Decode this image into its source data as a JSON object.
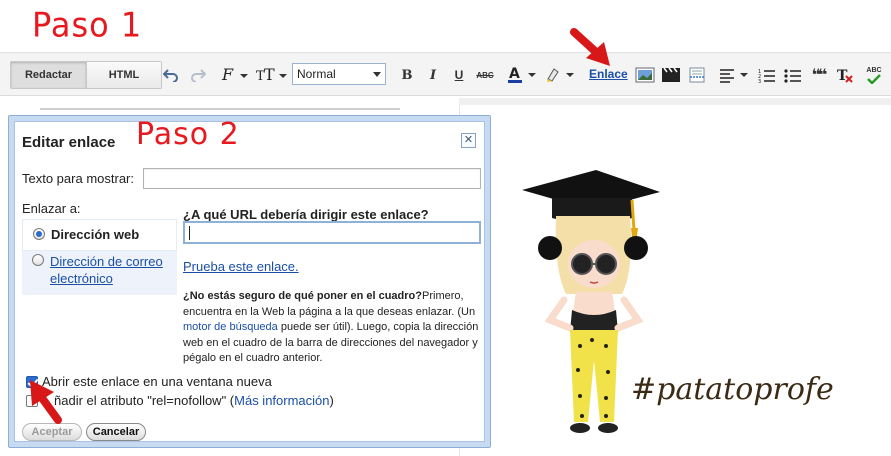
{
  "annotations": {
    "step1": "Paso 1",
    "step2": "Paso 2",
    "hashtag": "#patatoprofe"
  },
  "toolbar": {
    "mode_compose": "Redactar",
    "mode_html": "HTML",
    "font_size_value": "Normal",
    "bold": "B",
    "italic": "I",
    "underline": "U",
    "strike": "ABC",
    "link_label": "Enlace",
    "quote_glyph": "❝❝",
    "spell_label": "ABC"
  },
  "dialog": {
    "title": "Editar enlace",
    "close_glyph": "✕",
    "display_text_label": "Texto para mostrar:",
    "display_text_value": "",
    "link_to_label": "Enlazar a:",
    "options": [
      {
        "label": "Dirección web",
        "selected": true
      },
      {
        "label": "Dirección de correo electrónico",
        "selected": false
      }
    ],
    "url_question": "¿A qué URL debería dirigir este enlace?",
    "url_value": "",
    "test_link": "Prueba este enlace.",
    "help_bold": "¿No estás seguro de qué poner en el cuadro?",
    "help_text_1": "Primero, encuentra en la Web la página a la que deseas enlazar. (Un ",
    "help_link": "motor de búsqueda",
    "help_text_2": " puede ser útil). Luego, copia la dirección web en el cuadro de la barra de direcciones del navegador y pégalo en el cuadro anterior.",
    "checkbox_new_window": {
      "label": "Abrir este enlace en una ventana nueva",
      "checked": true
    },
    "checkbox_nofollow": {
      "label_visible": "ñadir el atributo \"rel=nofollow\" (",
      "link": "Más información",
      "label_end": ")",
      "checked": false
    },
    "accept_button": "Aceptar",
    "cancel_button": "Cancelar"
  },
  "colors": {
    "annotation_red": "#e8191e",
    "link_blue": "#1a4fa6",
    "dialog_frame": "#c6dbf2"
  }
}
